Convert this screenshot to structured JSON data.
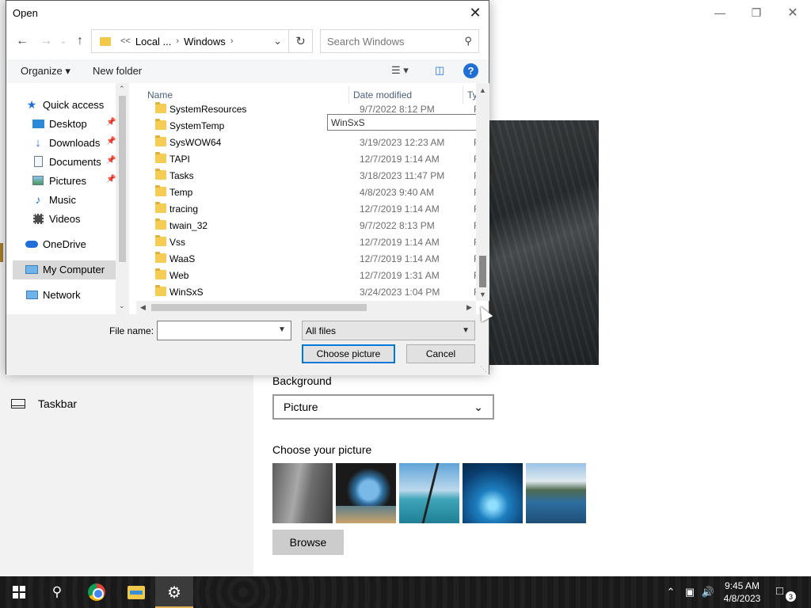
{
  "settings": {
    "nav_taskbar": "Taskbar",
    "background_label": "Background",
    "background_value": "Picture",
    "choose_label": "Choose your picture",
    "browse_label": "Browse"
  },
  "dialog": {
    "title": "Open",
    "address": [
      "Local ...",
      "Windows"
    ],
    "search_placeholder": "Search Windows",
    "toolbar": {
      "organize": "Organize",
      "new_folder": "New folder"
    },
    "nav": [
      {
        "label": "Quick access",
        "icon": "star-icon"
      },
      {
        "label": "Desktop",
        "icon": "desktop-icon",
        "pinned": true
      },
      {
        "label": "Downloads",
        "icon": "download-icon",
        "pinned": true
      },
      {
        "label": "Documents",
        "icon": "document-icon",
        "pinned": true
      },
      {
        "label": "Pictures",
        "icon": "pictures-icon",
        "pinned": true
      },
      {
        "label": "Music",
        "icon": "music-icon"
      },
      {
        "label": "Videos",
        "icon": "video-icon"
      },
      {
        "label": "OneDrive",
        "icon": "cloud-icon"
      },
      {
        "label": "My Computer",
        "icon": "computer-icon",
        "selected": true
      },
      {
        "label": "Network",
        "icon": "network-icon"
      }
    ],
    "columns": {
      "name": "Name",
      "date": "Date modified",
      "type": "Ty"
    },
    "files": [
      {
        "name": "SystemResources",
        "date": "9/7/2022 8:12 PM",
        "type": "Fi"
      },
      {
        "name": "SystemTemp",
        "date": "",
        "type": "Fi"
      },
      {
        "name": "SysWOW64",
        "date": "3/19/2023 12:23 AM",
        "type": "Fi"
      },
      {
        "name": "TAPI",
        "date": "12/7/2019 1:14 AM",
        "type": "Fi"
      },
      {
        "name": "Tasks",
        "date": "3/18/2023 11:47 PM",
        "type": "Fi"
      },
      {
        "name": "Temp",
        "date": "4/8/2023 9:40 AM",
        "type": "Fi"
      },
      {
        "name": "tracing",
        "date": "12/7/2019 1:14 AM",
        "type": "Fi"
      },
      {
        "name": "twain_32",
        "date": "9/7/2022 8:13 PM",
        "type": "Fi"
      },
      {
        "name": "Vss",
        "date": "12/7/2019 1:14 AM",
        "type": "Fi"
      },
      {
        "name": "WaaS",
        "date": "12/7/2019 1:14 AM",
        "type": "Fi"
      },
      {
        "name": "Web",
        "date": "12/7/2019 1:31 AM",
        "type": "Fi"
      },
      {
        "name": "WinSxS",
        "date": "3/24/2023 1:04 PM",
        "type": "Fi"
      }
    ],
    "rename_value": "WinSxS",
    "file_name_label": "File name:",
    "file_name_value": "",
    "filter_value": "All files",
    "choose_button": "Choose picture",
    "cancel_button": "Cancel"
  },
  "taskbar": {
    "time": "9:45 AM",
    "date": "4/8/2023",
    "notification_count": "3"
  }
}
